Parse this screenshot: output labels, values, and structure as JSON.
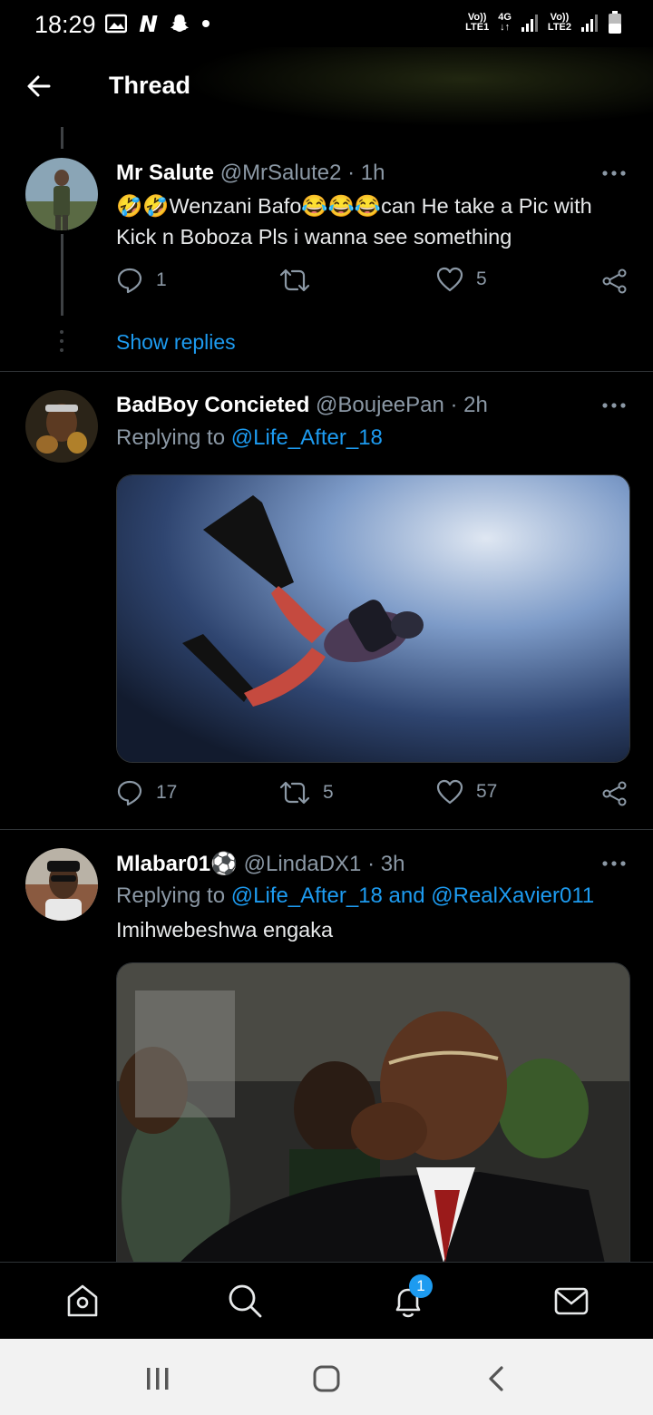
{
  "status_bar": {
    "time": "18:29",
    "sim1_top": "Vo))",
    "sim1_mid": "LTE1",
    "network": "4G",
    "sim2_top": "Vo))",
    "sim2_mid": "LTE2",
    "icons": [
      "gallery-icon",
      "netflix-icon",
      "snapchat-icon",
      "dot-icon",
      "signal-icon",
      "battery-icon"
    ]
  },
  "header": {
    "title": "Thread"
  },
  "tweets": [
    {
      "name": "Mr Salute",
      "handle": "@MrSalute2",
      "time": "· 1h",
      "text": "🤣🤣Wenzani Bafo😂😂😂can He take a Pic with Kick n Boboza Pls i wanna see something",
      "replies": "1",
      "retweets": "",
      "likes": "5",
      "show_replies": "Show replies"
    },
    {
      "name": "BadBoy Concieted",
      "handle": "@BoujeePan",
      "time": "· 2h",
      "replying_prefix": "Replying to",
      "replying_to": "@Life_After_18",
      "replies": "17",
      "retweets": "5",
      "likes": "57"
    },
    {
      "name": "Mlabar01⚽",
      "handle": "@LindaDX1",
      "time": "· 3h",
      "replying_prefix": "Replying to",
      "replying_to": "@Life_After_18 and @RealXavier011",
      "text": "Imihwebeshwa engaka"
    }
  ],
  "bottom_nav": {
    "items": [
      "home-icon",
      "search-icon",
      "notifications-icon",
      "messages-icon"
    ],
    "notification_count": "1"
  },
  "colors": {
    "accent": "#1d9bf0",
    "muted": "#8b98a5",
    "background": "#000000"
  }
}
